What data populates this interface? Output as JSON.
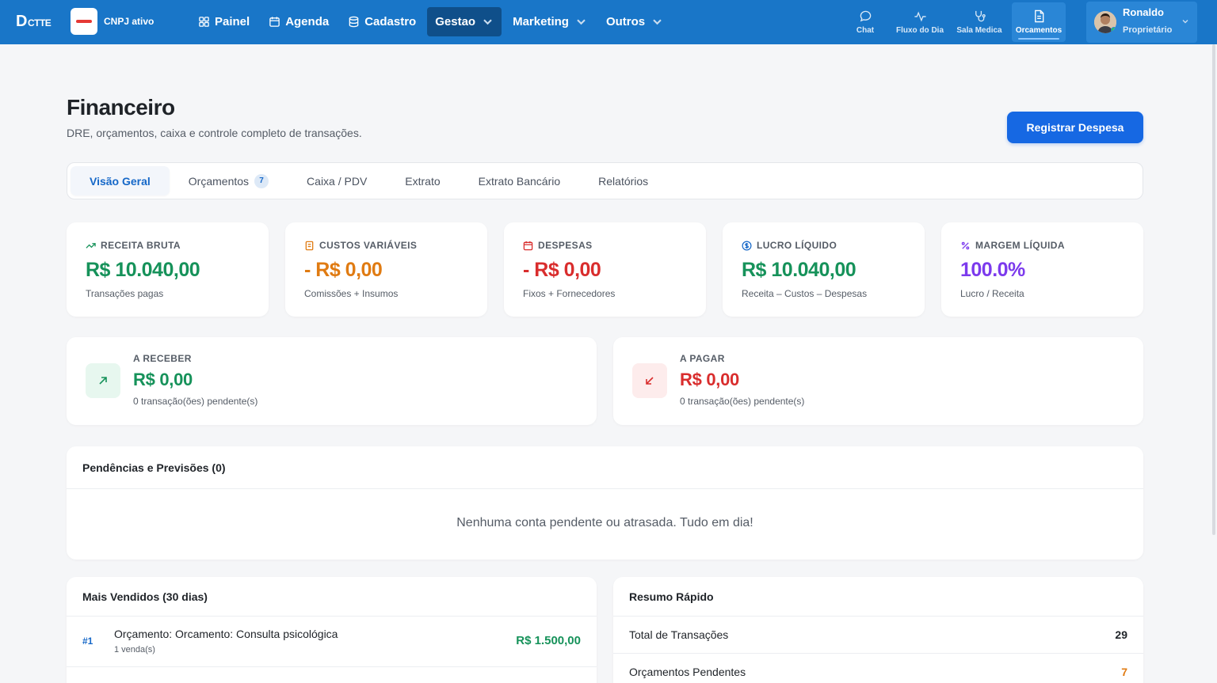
{
  "topbar": {
    "logo_main": "D",
    "logo_tail": "CTTE",
    "cnpj_status": "CNPJ ativo",
    "nav": [
      {
        "label": "Painel",
        "icon": "grid-icon"
      },
      {
        "label": "Agenda",
        "icon": "calendar-icon"
      },
      {
        "label": "Cadastro",
        "icon": "database-icon"
      },
      {
        "label": "Gestao",
        "icon": "chevron-down-icon",
        "active": true
      },
      {
        "label": "Marketing",
        "icon": "chevron-down-icon"
      },
      {
        "label": "Outros",
        "icon": "chevron-down-icon"
      }
    ],
    "quick": [
      {
        "label": "Chat",
        "icon": "chat-icon"
      },
      {
        "label": "Fluxo do Dia",
        "icon": "activity-icon"
      },
      {
        "label": "Sala Medica",
        "icon": "stethoscope-icon"
      },
      {
        "label": "Orcamentos",
        "icon": "document-icon",
        "active": true
      }
    ],
    "user": {
      "name": "Ronaldo",
      "role": "Proprietário"
    }
  },
  "header": {
    "title": "Financeiro",
    "subtitle": "DRE, orçamentos, caixa e controle completo de transações.",
    "primary_button": "Registrar Despesa"
  },
  "tabs": [
    {
      "label": "Visão Geral",
      "active": true
    },
    {
      "label": "Orçamentos",
      "count": "7"
    },
    {
      "label": "Caixa / PDV"
    },
    {
      "label": "Extrato"
    },
    {
      "label": "Extrato Bancário"
    },
    {
      "label": "Relatórios"
    }
  ],
  "kpis": [
    {
      "label": "RECEITA BRUTA",
      "value": "R$ 10.040,00",
      "note": "Transações pagas",
      "color": "#16925a",
      "icon": "trending-up-icon"
    },
    {
      "label": "CUSTOS VARIÁVEIS",
      "value": "- R$ 0,00",
      "note": "Comissões + Insumos",
      "color": "#e07b12",
      "icon": "receipt-icon"
    },
    {
      "label": "DESPESAS",
      "value": "- R$ 0,00",
      "note": "Fixos + Fornecedores",
      "color": "#d92d2d",
      "icon": "calendar-icon"
    },
    {
      "label": "LUCRO LÍQUIDO",
      "value": "R$ 10.040,00",
      "note": "Receita – Custos – Despesas",
      "color": "#16925a",
      "icon": "dollar-circle-icon"
    },
    {
      "label": "MARGEM LÍQUIDA",
      "value": "100.0%",
      "note": "Lucro / Receita",
      "color": "#7c3aed",
      "icon": "percent-icon"
    }
  ],
  "receivable": {
    "label": "A RECEBER",
    "value": "R$ 0,00",
    "note": "0 transação(ões) pendente(s)",
    "color": "#16925a"
  },
  "payable": {
    "label": "A PAGAR",
    "value": "R$ 0,00",
    "note": "0 transação(ões) pendente(s)",
    "color": "#d92d2d"
  },
  "pending": {
    "title": "Pendências e Previsões (0)",
    "empty": "Nenhuma conta pendente ou atrasada. Tudo em dia!"
  },
  "best_sellers": {
    "title": "Mais Vendidos (30 dias)",
    "items": [
      {
        "rank": "#1",
        "name": "Orçamento: Orcamento: Consulta psicológica",
        "sub": "1 venda(s)",
        "value": "R$ 1.500,00"
      }
    ]
  },
  "summary": {
    "title": "Resumo Rápido",
    "rows": [
      {
        "label": "Total de Transações",
        "value": "29",
        "color": "#1f2328"
      },
      {
        "label": "Orçamentos Pendentes",
        "value": "7",
        "color": "#e07b12"
      }
    ]
  }
}
